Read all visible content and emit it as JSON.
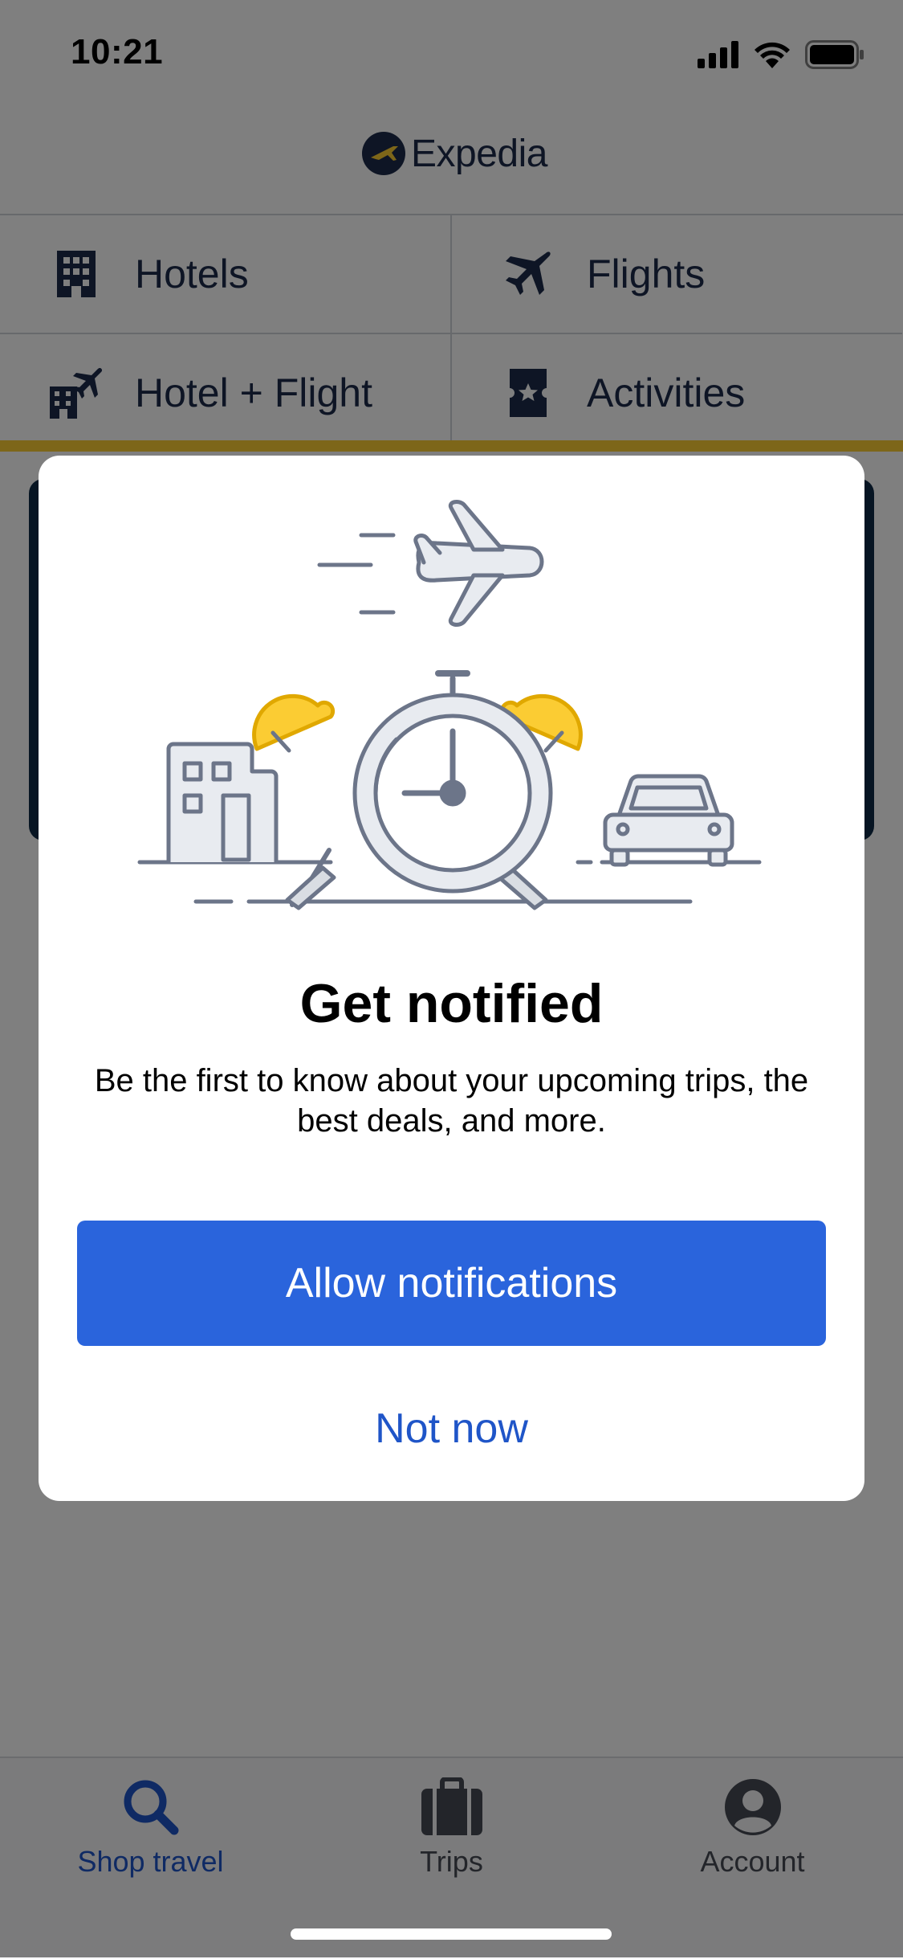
{
  "status_bar": {
    "time": "10:21"
  },
  "header": {
    "brand": "Expedia"
  },
  "categories": [
    {
      "label": "Hotels",
      "icon": "hotel-building-icon"
    },
    {
      "label": "Flights",
      "icon": "airplane-icon"
    },
    {
      "label": "Hotel + Flight",
      "icon": "hotel-flight-icon"
    },
    {
      "label": "Activities",
      "icon": "ticket-star-icon"
    }
  ],
  "modal": {
    "title": "Get notified",
    "body": "Be the first to know about your upcoming trips, the best deals, and more.",
    "primary_button": "Allow notifications",
    "secondary_button": "Not now"
  },
  "tab_bar": {
    "tabs": [
      {
        "label": "Shop travel",
        "icon": "search-icon",
        "active": true
      },
      {
        "label": "Trips",
        "icon": "suitcase-icon",
        "active": false
      },
      {
        "label": "Account",
        "icon": "account-icon",
        "active": false
      }
    ]
  },
  "colors": {
    "brand_navy": "#1c2b4a",
    "brand_gold": "#fbcc33",
    "primary_blue": "#2a64dc",
    "link_blue": "#1f55c8",
    "active_tab": "#1f55c8",
    "inactive_tab": "#474b55"
  }
}
